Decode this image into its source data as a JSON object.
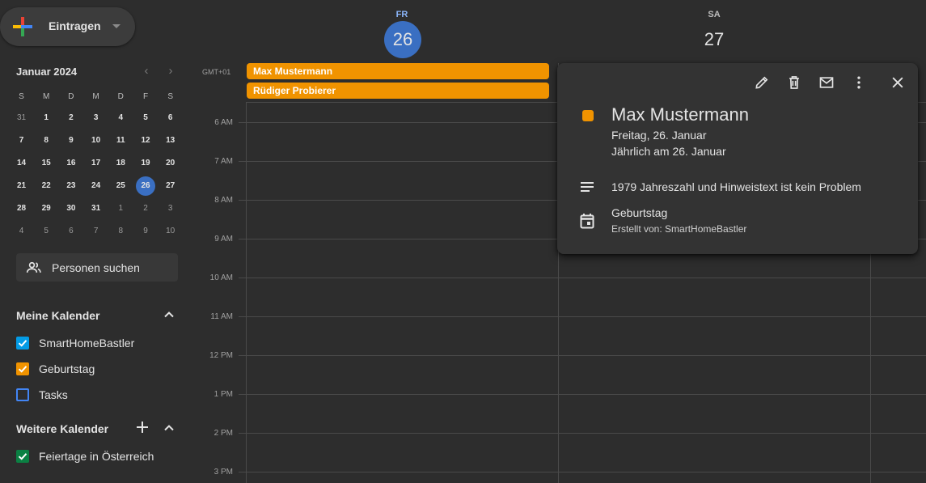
{
  "create": {
    "label": "Eintragen"
  },
  "mini_calendar": {
    "title": "Januar 2024",
    "weekdays": [
      "S",
      "M",
      "D",
      "M",
      "D",
      "F",
      "S"
    ],
    "weeks": [
      [
        "31",
        "1",
        "2",
        "3",
        "4",
        "5",
        "6"
      ],
      [
        "7",
        "8",
        "9",
        "10",
        "11",
        "12",
        "13"
      ],
      [
        "14",
        "15",
        "16",
        "17",
        "18",
        "19",
        "20"
      ],
      [
        "21",
        "22",
        "23",
        "24",
        "25",
        "26",
        "27"
      ],
      [
        "28",
        "29",
        "30",
        "31",
        "1",
        "2",
        "3"
      ],
      [
        "4",
        "5",
        "6",
        "7",
        "8",
        "9",
        "10"
      ]
    ]
  },
  "search_people": {
    "label": "Personen suchen"
  },
  "my_calendars": {
    "title": "Meine Kalender",
    "items": [
      {
        "label": "SmartHomeBastler",
        "checked": true,
        "color": "#039be5"
      },
      {
        "label": "Geburtstag",
        "checked": true,
        "color": "#f09300"
      },
      {
        "label": "Tasks",
        "checked": false,
        "color": "#4285f4"
      }
    ]
  },
  "other_calendars": {
    "title": "Weitere Kalender",
    "items": [
      {
        "label": "Feiertage in Österreich",
        "checked": true,
        "color": "#0b8043"
      }
    ]
  },
  "days": [
    {
      "dow": "FR",
      "num": "26",
      "today": true
    },
    {
      "dow": "SA",
      "num": "27",
      "today": false
    }
  ],
  "timezone": "GMT+01",
  "allday_events": [
    {
      "title": "Max Mustermann",
      "color": "#f09300"
    },
    {
      "title": "Rüdiger Probierer",
      "color": "#f09300"
    }
  ],
  "hours": [
    "6 AM",
    "7 AM",
    "8 AM",
    "9 AM",
    "10 AM",
    "11 AM",
    "12 PM",
    "1 PM",
    "2 PM",
    "3 PM"
  ],
  "popup": {
    "toolbar_icons": [
      "edit-icon",
      "delete-icon",
      "email-icon",
      "more-icon",
      "close-icon"
    ],
    "title": "Max Mustermann",
    "date": "Freitag, 26. Januar",
    "recurrence": "Jährlich am 26. Januar",
    "description": "1979  Jahreszahl und Hinweistext ist kein Problem",
    "calendar": "Geburtstag",
    "created_by": "Erstellt von: SmartHomeBastler",
    "color": "#f09300"
  },
  "colors": {
    "accent": "#3a6fc2",
    "today_dow": "#8ab4f8",
    "event": "#f09300"
  }
}
